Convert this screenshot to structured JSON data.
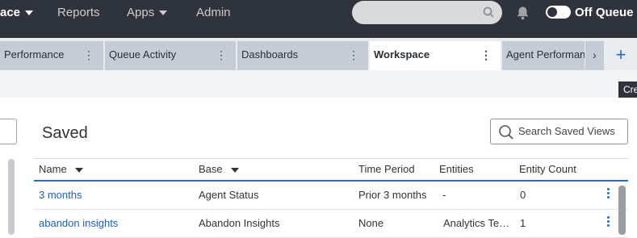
{
  "topnav": {
    "brand": "ace",
    "items": [
      {
        "label": "Reports"
      },
      {
        "label": "Apps"
      },
      {
        "label": "Admin"
      }
    ],
    "search_placeholder": "",
    "queue_toggle_label": "Off Queue"
  },
  "tabs": [
    {
      "label": "Performance",
      "active": false
    },
    {
      "label": "Queue Activity",
      "active": false
    },
    {
      "label": "Dashboards",
      "active": false
    },
    {
      "label": "Workspace",
      "active": true
    },
    {
      "label": "Agent Performance",
      "active": false
    }
  ],
  "tab_scroll_glyph": "›",
  "tab_add_glyph": "+",
  "tooltip": "Cre",
  "page": {
    "heading": "Saved",
    "search_label": "Search Saved Views"
  },
  "table": {
    "columns": [
      "Name",
      "Base",
      "Time Period",
      "Entities",
      "Entity Count"
    ],
    "rows": [
      {
        "name": "3 months",
        "base": "Agent Status",
        "time_period": "Prior 3 months",
        "entities": "-",
        "count": "0"
      },
      {
        "name": "abandon insights",
        "base": "Abandon Insights",
        "time_period": "None",
        "entities": "Analytics Te…",
        "count": "1"
      }
    ]
  },
  "colors": {
    "topbar": "#2f333c",
    "accent": "#2a6bb7",
    "tab_inactive": "#c5ccd6"
  }
}
